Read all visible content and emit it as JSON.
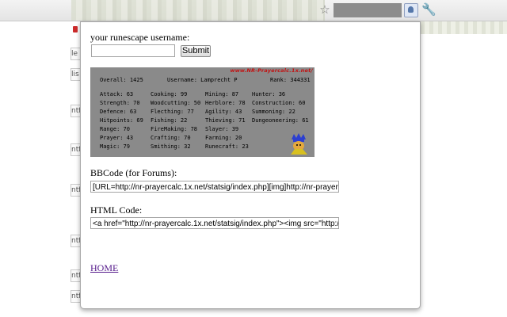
{
  "popup": {
    "username_label": "your runescape username:",
    "username_value": "",
    "submit_label": "Submit",
    "bbcode_label": "BBCode (for Forums):",
    "bbcode_value": "[URL=http://nr-prayercalc.1x.net/statsig/index.php][img]http://nr-prayercalc.1x.net/",
    "html_label": "HTML Code:",
    "html_value": "<a href=\"http://nr-prayercalc.1x.net/statsig/index.php\"><img src=\"http://nr-prayercalc.1x.net/",
    "home_label": "HOME"
  },
  "signature": {
    "site": "www.NR-Prayercalc.1x.net/",
    "overall": "Overall: 1425",
    "username": "Username: Lamprecht P",
    "rank": "Rank: 344331",
    "columns": [
      [
        "Attack: 63",
        "Strength: 70",
        "Defence: 63",
        "Hitpoints: 69",
        "Range: 70",
        "Prayer: 43",
        "Magic: 79"
      ],
      [
        "Cooking: 99",
        "Woodcutting: 50",
        "Flecthing: 77",
        "Fishing: 22",
        "FireMaking: 78",
        "Crafting: 70",
        "Smithing: 32"
      ],
      [
        "Mining: 87",
        "Herblore: 78",
        "Agility: 43",
        "Thieving: 71",
        "Slayer: 39",
        "Farming: 20",
        "Runecraft: 23"
      ],
      [
        "Hunter: 36",
        "Construction: 60",
        "Summoning: 22",
        "Dungeoneering: 61"
      ]
    ]
  },
  "background": {
    "tab_letters": [
      "le",
      "lis",
      "ntf",
      "ntf",
      "ntf",
      "ntf",
      "ntf",
      "ntf"
    ]
  },
  "colors": {
    "link": "#551a8b",
    "sig_background": "#8a8a8a",
    "sig_url": "#c21313"
  }
}
